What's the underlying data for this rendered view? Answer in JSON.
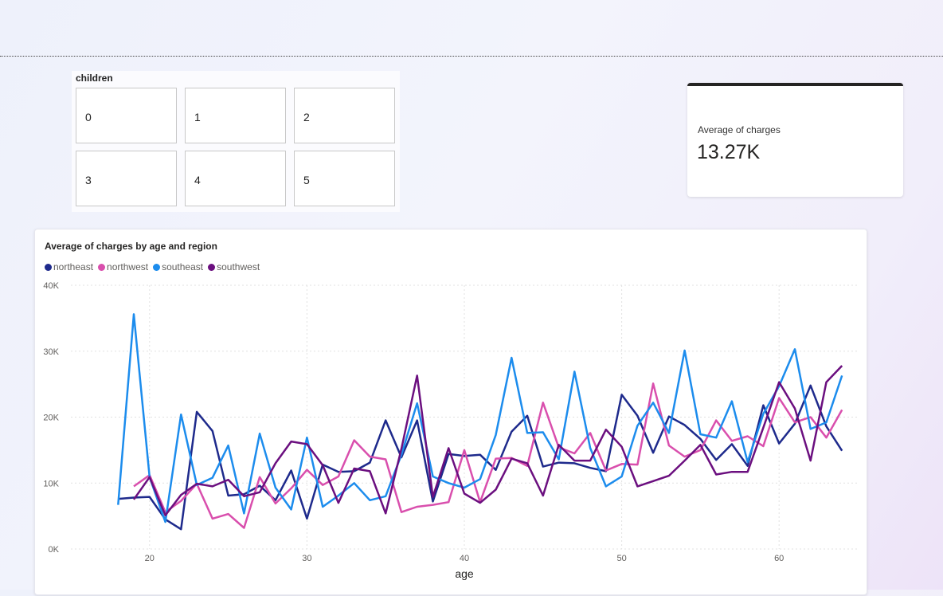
{
  "slicer": {
    "title": "children",
    "options": [
      "0",
      "1",
      "2",
      "3",
      "4",
      "5"
    ]
  },
  "card": {
    "label": "Average of charges",
    "value": "13.27K"
  },
  "chart": {
    "title": "Average of charges by age and region"
  },
  "colors": {
    "northeast": "#1e2a8c",
    "northwest": "#d94fad",
    "southeast": "#1c8ced",
    "southwest": "#6b0f7f"
  },
  "chart_data": {
    "type": "line",
    "title": "Average of charges by age and region",
    "xlabel": "age",
    "ylabel": "",
    "xlim": [
      15,
      65
    ],
    "ylim": [
      0,
      40000
    ],
    "x_ticks": [
      20,
      30,
      40,
      50,
      60
    ],
    "y_ticks": [
      0,
      10000,
      20000,
      30000,
      40000
    ],
    "y_tick_labels": [
      "0K",
      "10K",
      "20K",
      "30K",
      "40K"
    ],
    "grid": true,
    "legend_position": "top-left",
    "x": [
      18,
      19,
      20,
      21,
      22,
      23,
      24,
      25,
      26,
      27,
      28,
      29,
      30,
      31,
      32,
      33,
      34,
      35,
      36,
      37,
      38,
      39,
      40,
      41,
      42,
      43,
      44,
      45,
      46,
      47,
      48,
      49,
      50,
      51,
      52,
      53,
      54,
      55,
      56,
      57,
      58,
      59,
      60,
      61,
      62,
      63,
      64
    ],
    "series": [
      {
        "name": "northeast",
        "values": [
          7600,
          7800,
          7900,
          4500,
          3000,
          20800,
          17900,
          8100,
          8300,
          9600,
          7400,
          11900,
          4600,
          12800,
          11700,
          11800,
          13100,
          19500,
          13900,
          19500,
          7200,
          14400,
          14100,
          14300,
          12000,
          17800,
          20200,
          12500,
          13100,
          13000,
          12300,
          11800,
          23400,
          20200,
          14600,
          20100,
          18800,
          16700,
          13500,
          15900,
          12600,
          21800,
          16000,
          19000,
          24800,
          18600,
          14900
        ]
      },
      {
        "name": "northwest",
        "values": [
          null,
          9500,
          11200,
          5600,
          7300,
          9900,
          4600,
          5300,
          3200,
          10900,
          6900,
          9200,
          12000,
          9700,
          11000,
          16500,
          14000,
          13600,
          5600,
          6400,
          6700,
          7100,
          15000,
          7100,
          13700,
          13800,
          12600,
          22200,
          15400,
          14500,
          17600,
          11900,
          12900,
          12800,
          25100,
          15700,
          14000,
          15000,
          19500,
          16400,
          17100,
          15600,
          22900,
          19200,
          20000,
          16900,
          21100
        ]
      },
      {
        "name": "southeast",
        "values": [
          6700,
          35600,
          10900,
          4100,
          20400,
          9700,
          10800,
          15700,
          5400,
          17500,
          9300,
          6000,
          16900,
          6400,
          8100,
          10000,
          7400,
          8000,
          14300,
          22100,
          11000,
          10000,
          9300,
          10600,
          17300,
          29000,
          17600,
          17700,
          13600,
          26900,
          15300,
          9500,
          11000,
          18700,
          22200,
          17600,
          30100,
          17400,
          16900,
          22400,
          13200,
          20500,
          24700,
          30300,
          18200,
          19200,
          26300
        ]
      },
      {
        "name": "southwest",
        "values": [
          null,
          7500,
          10900,
          5100,
          8200,
          9900,
          9500,
          10500,
          8000,
          8600,
          13000,
          16300,
          15900,
          12700,
          7000,
          12200,
          11800,
          5400,
          15200,
          26300,
          7900,
          15300,
          8400,
          7000,
          9000,
          13700,
          13000,
          8100,
          15800,
          13400,
          13400,
          18100,
          15500,
          9500,
          10300,
          11100,
          13400,
          15800,
          11300,
          11700,
          11700,
          18400,
          25300,
          21300,
          13400,
          25300,
          27800
        ]
      }
    ]
  }
}
